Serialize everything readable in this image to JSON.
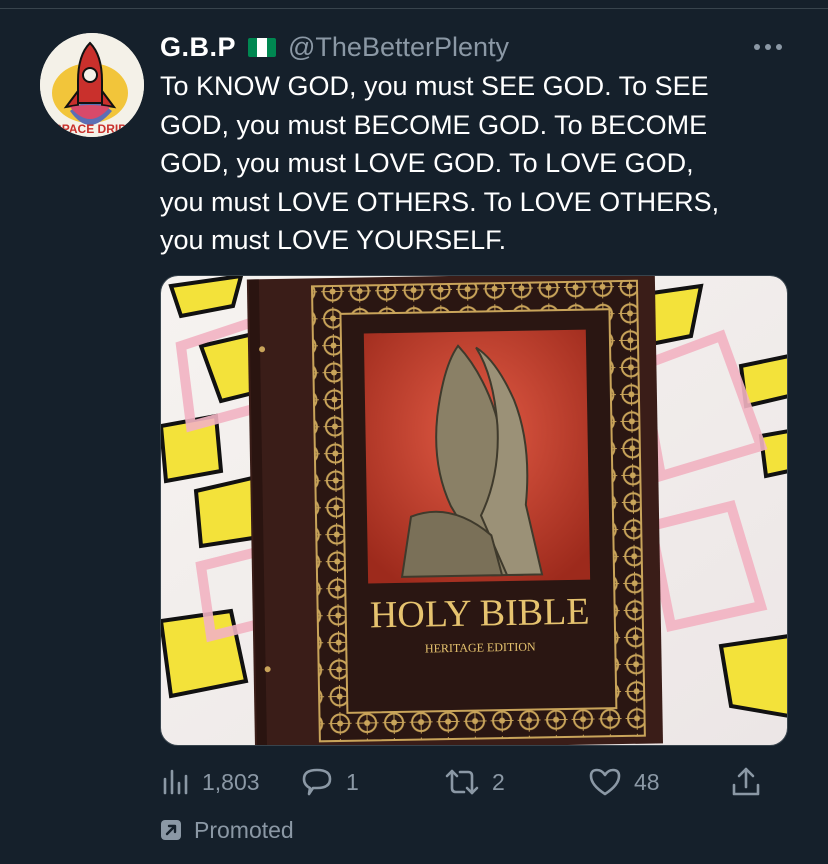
{
  "author": {
    "name": "G.B.P",
    "flag": "nigeria-flag",
    "handle": "@TheBetterPlenty",
    "avatar_text": "SPACE DRIP"
  },
  "tweet": {
    "text": "To KNOW GOD, you must SEE GOD. To SEE\nGOD, you must BECOME GOD. To BECOME\nGOD, you must LOVE GOD. To LOVE GOD,\nyou must LOVE OTHERS. To LOVE OTHERS,\nyou must LOVE YOURSELF."
  },
  "media": {
    "book_title": "HOLY BIBLE",
    "book_subtitle": "HERITAGE EDITION"
  },
  "actions": {
    "views": "1,803",
    "replies": "1",
    "retweets": "2",
    "likes": "48"
  },
  "promoted_label": "Promoted",
  "colors": {
    "background": "#15202b",
    "secondary_text": "#8b98a5",
    "divider": "#38444d",
    "flag_green": "#008751"
  }
}
